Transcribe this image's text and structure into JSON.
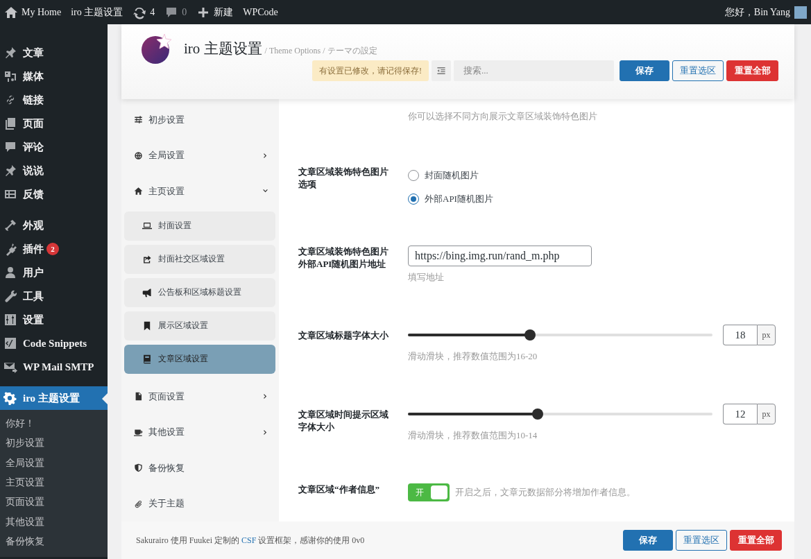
{
  "admin_bar": {
    "items": [
      {
        "kind": "home",
        "label": "My Home"
      },
      {
        "kind": "text",
        "label": "iro 主题设置"
      },
      {
        "kind": "updates",
        "label": "4"
      },
      {
        "kind": "comments",
        "label": "0"
      },
      {
        "kind": "new",
        "label": "新建"
      },
      {
        "kind": "text",
        "label": "WPCode"
      }
    ],
    "greeting": "您好，Bin Yang"
  },
  "sidebar": {
    "sections": [
      {
        "items": [
          {
            "label": "文章",
            "selected": false
          },
          {
            "label": "媒体",
            "selected": false
          },
          {
            "label": "链接",
            "selected": false
          },
          {
            "label": "页面",
            "selected": false
          },
          {
            "label": "评论",
            "selected": false
          },
          {
            "label": "说说",
            "selected": false
          },
          {
            "label": "反馈",
            "selected": false
          }
        ]
      },
      {
        "items": [
          {
            "label": "外观",
            "selected": false
          },
          {
            "label": "插件",
            "badge": "2",
            "selected": false
          },
          {
            "label": "用户",
            "selected": false
          },
          {
            "label": "工具",
            "selected": false
          },
          {
            "label": "设置",
            "selected": false
          },
          {
            "label": "Code Snippets",
            "selected": false
          },
          {
            "label": "WP Mail SMTP",
            "selected": false
          }
        ]
      },
      {
        "items": [
          {
            "label": "iro 主题设置",
            "selected": true,
            "submenu": [
              "你好！",
              "初步设置",
              "全局设置",
              "主页设置",
              "页面设置",
              "其他设置",
              "备份恢复"
            ]
          }
        ]
      }
    ]
  },
  "header": {
    "title": "iro 主题设置",
    "subtitle": "/ Theme Options / テーマの設定",
    "notice": "有设置已修改，请记得保存!",
    "search": {
      "placeholder": "搜索..."
    },
    "buttons": [
      {
        "kind": "primary",
        "label": "保存"
      },
      {
        "kind": "secondary",
        "label": "重置选区"
      },
      {
        "kind": "danger",
        "label": "重置全部"
      }
    ]
  },
  "options_nav": {
    "items": [
      {
        "label": "初步设置"
      },
      {
        "label": "全局设置",
        "expanded": false
      },
      {
        "label": "主页设置",
        "expanded": true,
        "children": [
          {
            "label": "封面设置",
            "selected": false
          },
          {
            "label": "封面社交区域设置",
            "selected": false
          },
          {
            "label": "公告板和区域标题设置",
            "selected": false
          },
          {
            "label": "展示区域设置",
            "selected": false
          },
          {
            "label": "文章区域设置",
            "selected": true
          }
        ]
      },
      {
        "label": "页面设置",
        "expanded": false
      },
      {
        "label": "其他设置",
        "expanded": false
      },
      {
        "label": "备份恢复"
      },
      {
        "label": "关于主题"
      }
    ]
  },
  "fields": [
    {
      "kind": "description",
      "text": "你可以选择不同方向展示文章区域装饰特色图片"
    },
    {
      "kind": "radio",
      "label": "文章区域装饰特色图片选项",
      "options": [
        {
          "label": "封面随机图片",
          "selected": false
        },
        {
          "label": "外部API随机图片",
          "selected": true
        }
      ]
    },
    {
      "kind": "text",
      "label": "文章区域装饰特色图片外部API随机图片地址",
      "value": "https://bing.img.run/rand_m.php",
      "help": "填写地址"
    },
    {
      "kind": "slider",
      "label": "文章区域标题字体大小",
      "level": 0.4,
      "value": "18",
      "unit": "px",
      "help": "滑动滑块，推荐数值范围为16-20"
    },
    {
      "kind": "slider",
      "label": "文章区域时间提示区域字体大小",
      "level": 0.427,
      "value": "12",
      "unit": "px",
      "help": "滑动滑块，推荐数值范围为10-14"
    },
    {
      "kind": "switch",
      "label": "文章区域“作者信息”",
      "on": true,
      "switch_label": "开",
      "help": "开启之后，文章元数据部分将增加作者信息。"
    }
  ],
  "footer": {
    "text_before": "Sakurairo 使用 Fuukei 定制的 ",
    "link": "CSF",
    "text_after": " 设置框架，感谢你的使用 0v0",
    "buttons": [
      {
        "kind": "primary",
        "label": "保存"
      },
      {
        "kind": "secondary",
        "label": "重置选区"
      },
      {
        "kind": "danger",
        "label": "重置全部"
      }
    ]
  }
}
